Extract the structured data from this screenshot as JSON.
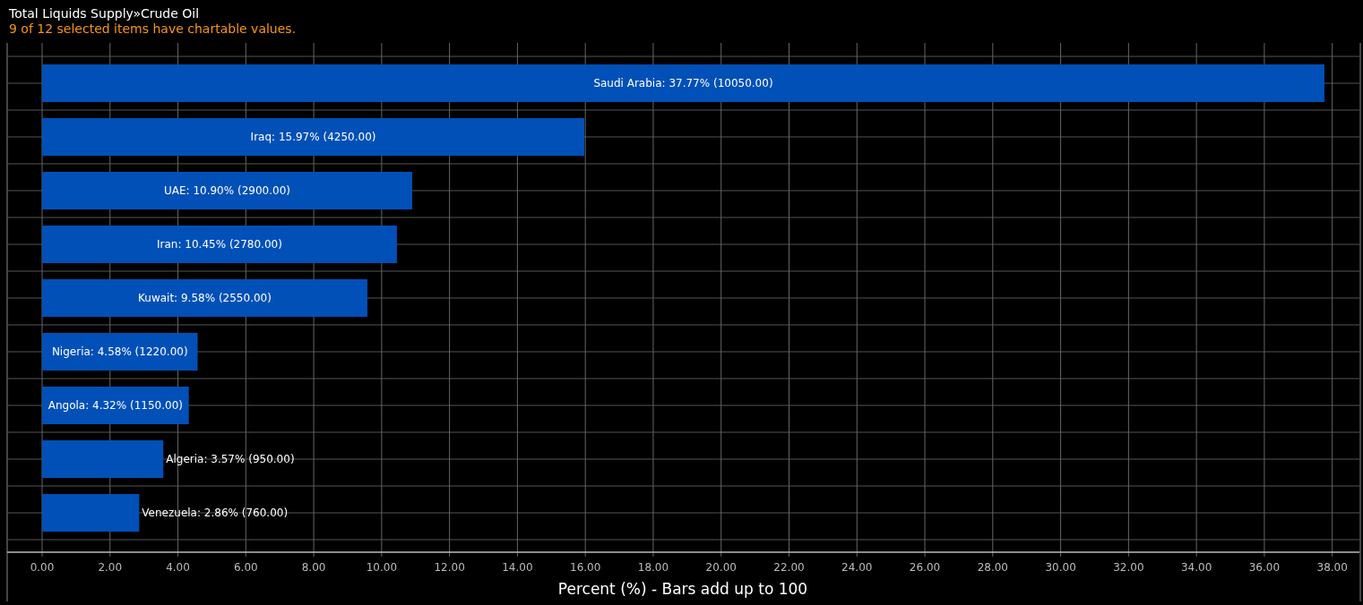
{
  "header": {
    "title": "Total Liquids Supply»Crude Oil",
    "notice": "9 of 12 selected items have chartable values."
  },
  "chart": {
    "chart_data": {
      "type": "bar",
      "orientation": "horizontal",
      "xlabel": "Percent (%) - Bars add up to 100",
      "grid": true,
      "series": [
        {
          "color": "#0050b8",
          "values": [
            37.77,
            15.97,
            10.9,
            10.45,
            9.58,
            4.58,
            4.32,
            3.57,
            2.86
          ]
        }
      ],
      "value_labels": [
        "Saudi Arabia: 37.77% (10050.00)",
        "Iraq: 15.97% (4250.00)",
        "UAE: 10.90% (2900.00)",
        "Iran: 10.45% (2780.00)",
        "Kuwait: 9.58% (2550.00)",
        "Nigeria: 4.58% (1220.00)",
        "Angola: 4.32% (1150.00)",
        "Algeria: 3.57% (950.00)",
        "Venezuela: 2.86% (760.00)"
      ],
      "xlim": [
        0,
        38.8
      ],
      "xticks": [
        {
          "value": 0,
          "label": "0.00"
        },
        {
          "value": 2,
          "label": "2.00"
        },
        {
          "value": 4,
          "label": "4.00"
        },
        {
          "value": 6,
          "label": "6.00"
        },
        {
          "value": 8,
          "label": "8.00"
        },
        {
          "value": 10,
          "label": "10.00"
        },
        {
          "value": 12,
          "label": "12.00"
        },
        {
          "value": 14,
          "label": "14.00"
        },
        {
          "value": 16,
          "label": "16.00"
        },
        {
          "value": 18,
          "label": "18.00"
        },
        {
          "value": 20,
          "label": "20.00"
        },
        {
          "value": 22,
          "label": "22.00"
        },
        {
          "value": 24,
          "label": "24.00"
        },
        {
          "value": 26,
          "label": "26.00"
        },
        {
          "value": 28,
          "label": "28.00"
        },
        {
          "value": 30,
          "label": "30.00"
        },
        {
          "value": 32,
          "label": "32.00"
        },
        {
          "value": 34,
          "label": "34.00"
        },
        {
          "value": 36,
          "label": "36.00"
        },
        {
          "value": 38,
          "label": "38.00"
        }
      ]
    }
  }
}
